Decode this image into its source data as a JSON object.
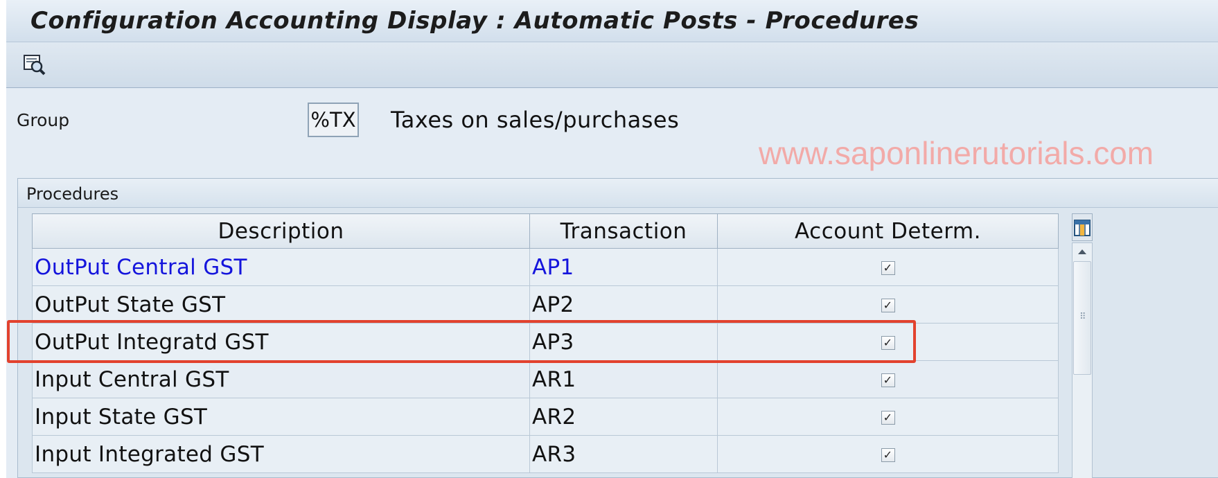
{
  "window": {
    "title": "Configuration Accounting Display : Automatic Posts - Procedures"
  },
  "toolbar": {
    "buttons": [
      {
        "icon": "display-magnifier-icon"
      }
    ]
  },
  "group": {
    "label": "Group",
    "value": "%TX",
    "description": "Taxes on sales/purchases"
  },
  "watermark": "www.saponlinerutorials.com",
  "procedures": {
    "title": "Procedures",
    "columns": [
      "Description",
      "Transaction",
      "Account Determ."
    ],
    "rows": [
      {
        "description": "OutPut Central GST",
        "transaction": "AP1",
        "account_determ": true
      },
      {
        "description": "OutPut State GST",
        "transaction": "AP2",
        "account_determ": true
      },
      {
        "description": "OutPut Integratd GST",
        "transaction": "AP3",
        "account_determ": true
      },
      {
        "description": "Input Central GST",
        "transaction": "AR1",
        "account_determ": true
      },
      {
        "description": "Input State GST",
        "transaction": "AR2",
        "account_determ": true
      },
      {
        "description": "Input Integrated GST",
        "transaction": "AR3",
        "account_determ": true
      }
    ],
    "highlighted_row": 3,
    "link_row": 0
  },
  "colors": {
    "link": "#1414dc",
    "highlight": "#e2422e",
    "watermark": "#f2aaa8"
  }
}
